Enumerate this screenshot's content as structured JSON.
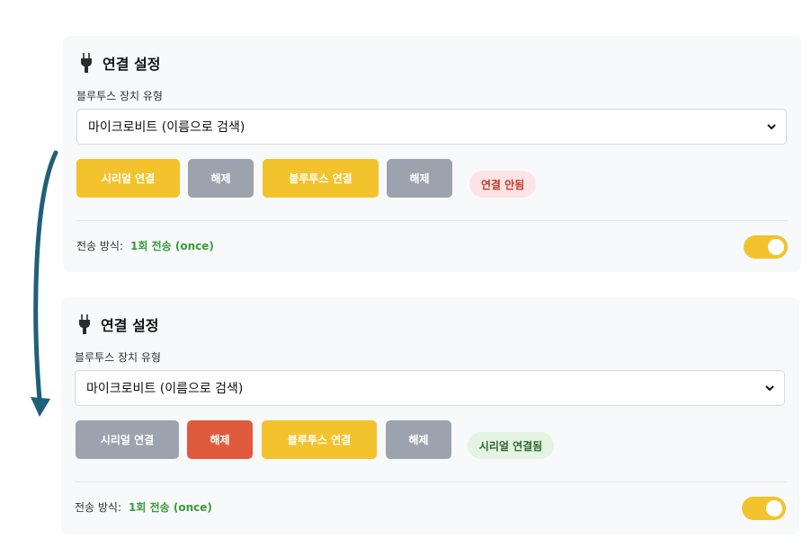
{
  "panels": [
    {
      "title": "연결 설정",
      "device_type_label": "블루투스 장치 유형",
      "device_type_value": "마이크로비트 (이름으로 검색)",
      "buttons": {
        "serial_connect": "시리얼 연결",
        "serial_disconnect": "해제",
        "bluetooth_connect": "블루투스 연결",
        "bluetooth_disconnect": "해제"
      },
      "status": "연결 안됨",
      "transfer_mode_label": "전송 방식:",
      "transfer_mode_value": "1회 전송 (once)",
      "toggle_on": true
    },
    {
      "title": "연결 설정",
      "device_type_label": "블루투스 장치 유형",
      "device_type_value": "마이크로비트 (이름으로 검색)",
      "buttons": {
        "serial_connect": "시리얼 연결",
        "serial_disconnect": "해제",
        "bluetooth_connect": "블루투스 연결",
        "bluetooth_disconnect": "해제"
      },
      "status": "시리얼 연결됨",
      "transfer_mode_label": "전송 방식:",
      "transfer_mode_value": "1회 전송 (once)",
      "toggle_on": true
    }
  ],
  "colors": {
    "accent_yellow": "#f3c32e",
    "disabled_gray": "#9ca3ae",
    "disconnect_red": "#e05a3d",
    "status_off_text": "#c0392b",
    "status_on_text": "#2d6a2d",
    "mode_value_green": "#3a9a3a",
    "arrow": "#1f5f7a"
  },
  "icons": {
    "title_icon": "plug-icon",
    "select_icon": "chevron-down-icon"
  }
}
